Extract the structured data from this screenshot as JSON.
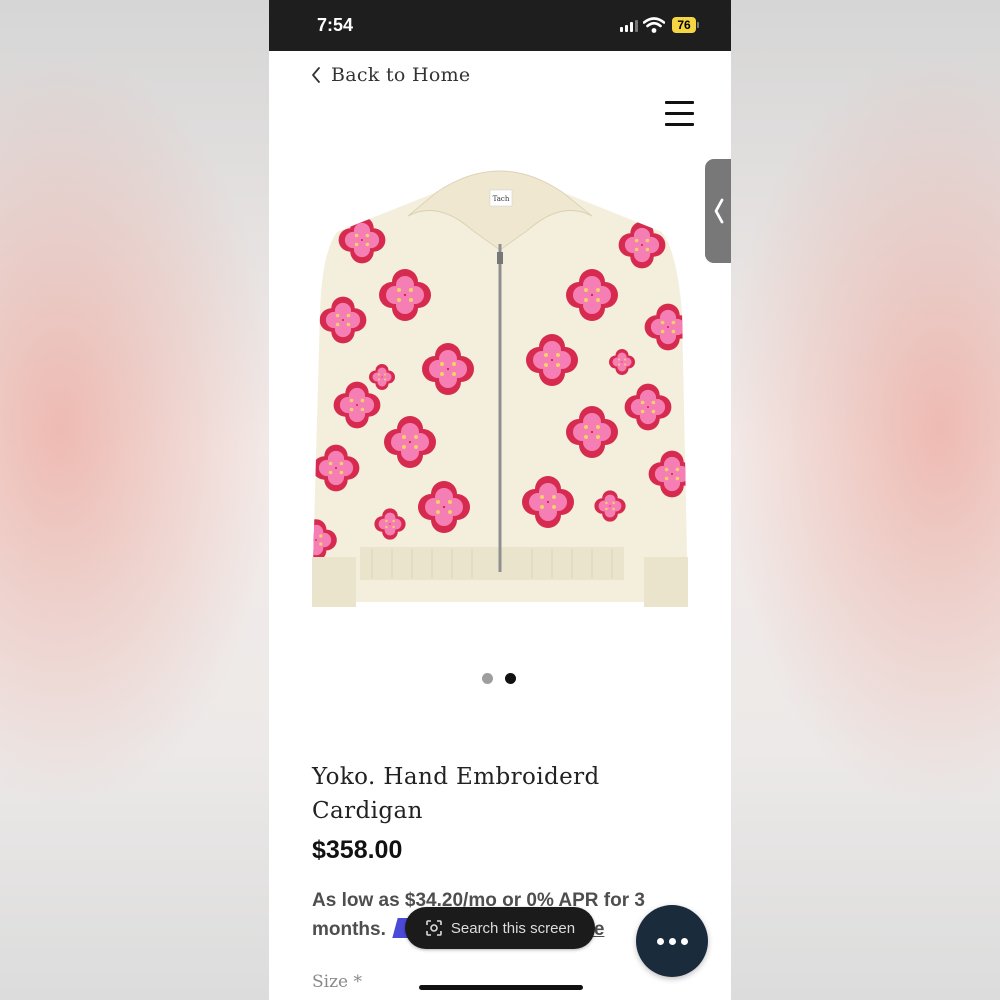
{
  "status_bar": {
    "time": "7:54",
    "battery": "76"
  },
  "nav": {
    "back_label": "Back to Home"
  },
  "carousel": {
    "dots": 2,
    "active_index": 1
  },
  "product": {
    "title": "Yoko. Hand Embroiderd Cardigan",
    "price": "$358.00",
    "brand_tag": "Tach",
    "financing_text": "As low as $34.20/mo or 0% APR for 3 months.",
    "financing_link": "re"
  },
  "overlay": {
    "search_label": "Search this screen"
  },
  "form": {
    "size_label": "Size *"
  },
  "colors": {
    "status_bar": "#1e1e1e",
    "fab": "#1a2b3c",
    "cardigan": "#f4efdc",
    "flower_outer": "#d62a4f",
    "flower_inner": "#f57fb4"
  }
}
